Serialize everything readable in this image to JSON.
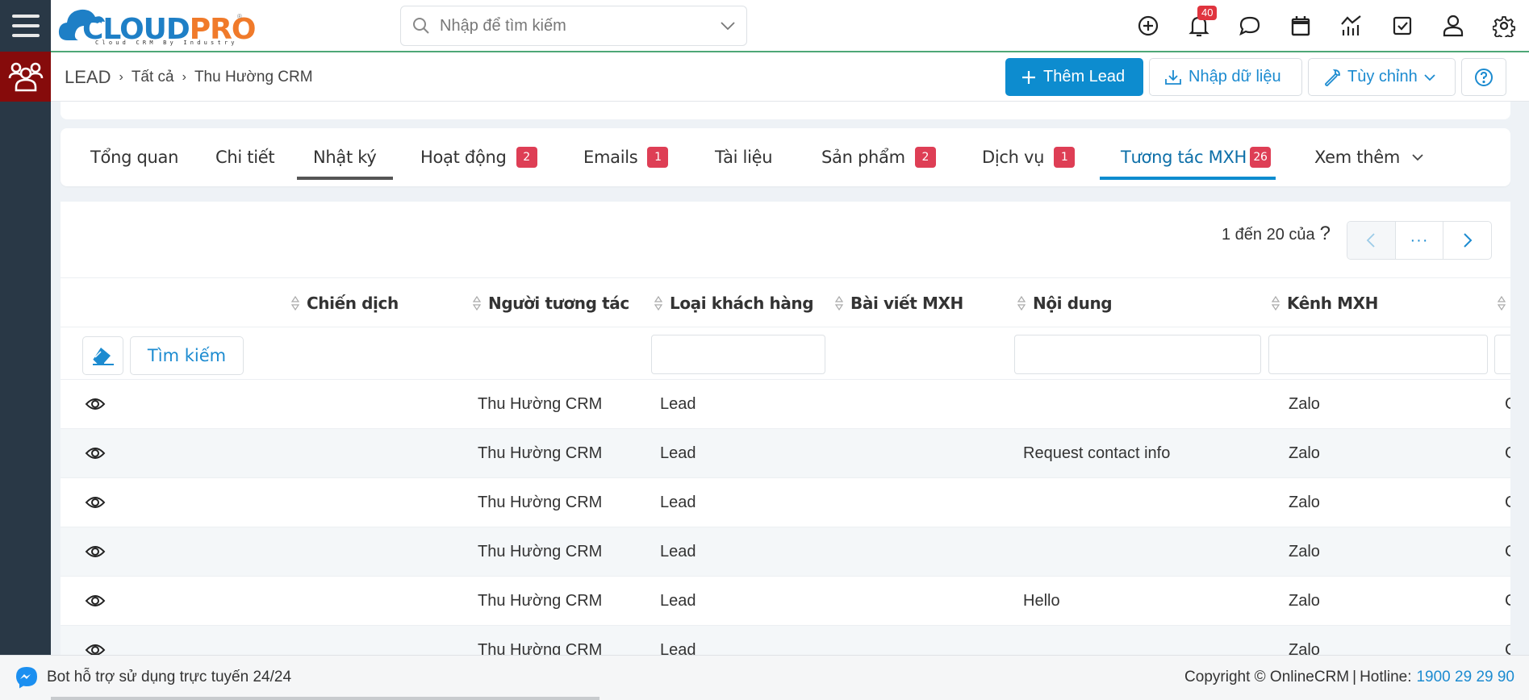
{
  "app": {
    "logo_text_blue": "CLOUD",
    "logo_text_orange": "PRO",
    "logo_tagline": "Cloud CRM By Industry",
    "logo_reg": "®"
  },
  "header": {
    "search_placeholder": "Nhập để tìm kiếm",
    "notifications_count": "40",
    "icons": [
      "add-icon",
      "bell-icon",
      "chat-icon",
      "calendar-icon",
      "report-icon",
      "task-icon",
      "user-icon",
      "settings-icon"
    ]
  },
  "breadcrumb": {
    "module": "LEAD",
    "items": [
      "Tất cả",
      "Thu Hường CRM"
    ]
  },
  "actions": {
    "add_label": "Thêm Lead",
    "import_label": "Nhập dữ liệu",
    "customize_label": "Tùy chỉnh"
  },
  "tabs": [
    {
      "label": "Tổng quan",
      "count": null
    },
    {
      "label": "Chi tiết",
      "count": null
    },
    {
      "label": "Nhật ký",
      "count": null
    },
    {
      "label": "Hoạt động",
      "count": "2"
    },
    {
      "label": "Emails",
      "count": "1"
    },
    {
      "label": "Tài liệu",
      "count": null
    },
    {
      "label": "Sản phẩm",
      "count": "2"
    },
    {
      "label": "Dịch vụ",
      "count": "1"
    },
    {
      "label": "Tương tác MXH",
      "count": "26"
    },
    {
      "label": "Xem thêm",
      "count": null
    }
  ],
  "active_tab": "Tương tác MXH",
  "pagination": {
    "range_text": "1 đến 20 của",
    "total_text": "?",
    "dots": "···"
  },
  "table": {
    "columns": [
      "Chiến dịch",
      "Người tương tác",
      "Loại khách hàng",
      "Bài viết MXH",
      "Nội dung",
      "Kênh MXH"
    ],
    "search_label": "Tìm kiếm",
    "rows": [
      {
        "campaign": "",
        "actor": "Thu Hường CRM",
        "customer_type": "Lead",
        "post": "",
        "content": "",
        "channel": "Zalo",
        "extra": "C"
      },
      {
        "campaign": "",
        "actor": "Thu Hường CRM",
        "customer_type": "Lead",
        "post": "",
        "content": "Request contact info",
        "channel": "Zalo",
        "extra": "C"
      },
      {
        "campaign": "",
        "actor": "Thu Hường CRM",
        "customer_type": "Lead",
        "post": "",
        "content": "",
        "channel": "Zalo",
        "extra": "C"
      },
      {
        "campaign": "",
        "actor": "Thu Hường CRM",
        "customer_type": "Lead",
        "post": "",
        "content": "",
        "channel": "Zalo",
        "extra": "C"
      },
      {
        "campaign": "",
        "actor": "Thu Hường CRM",
        "customer_type": "Lead",
        "post": "",
        "content": "Hello",
        "channel": "Zalo",
        "extra": "C"
      },
      {
        "campaign": "",
        "actor": "Thu Hường CRM",
        "customer_type": "Lead",
        "post": "",
        "content": "",
        "channel": "Zalo",
        "extra": "C"
      }
    ]
  },
  "footer": {
    "bot_text": "Bot hỗ trợ sử dụng trực tuyến 24/24",
    "copyright": "Copyright © OnlineCRM",
    "separator": "|",
    "hotline_label": "Hotline:",
    "hotline_number": "1900 29 29 90"
  },
  "colors": {
    "accent": "#0d8ccf",
    "badge": "#de3e55",
    "sidebar": "#293846",
    "module": "#860b0b",
    "header_border": "#4ea777"
  }
}
